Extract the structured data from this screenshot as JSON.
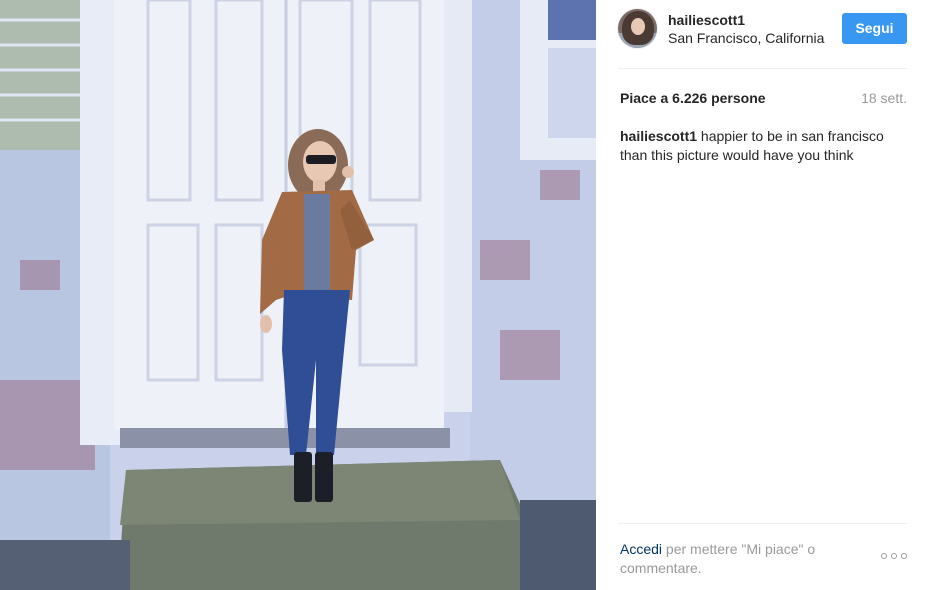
{
  "post": {
    "username": "hailiescott1",
    "location": "San Francisco, California",
    "follow_label": "Segui",
    "likes": "Piace a 6.226 persone",
    "date": "18 sett.",
    "caption_user": "hailiescott1",
    "caption_text": " happier to be in san francisco than this picture would have you think"
  },
  "footer": {
    "login_link": "Accedi",
    "prompt": " per mettere \"Mi piace\" o commentare."
  },
  "icons": {
    "more_options": "ellipsis-icon"
  }
}
